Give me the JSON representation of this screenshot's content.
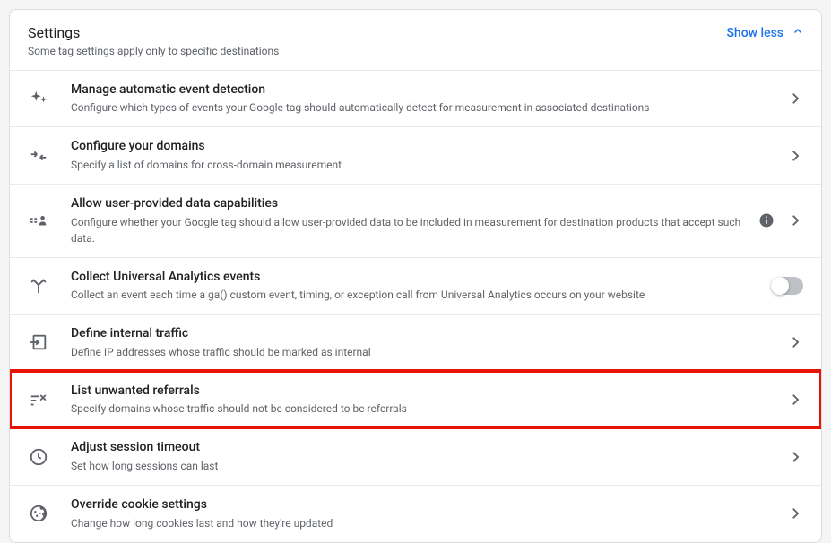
{
  "header": {
    "title": "Settings",
    "subtitle": "Some tag settings apply only to specific destinations",
    "toggle_label": "Show less"
  },
  "rows": [
    {
      "title": "Manage automatic event detection",
      "desc": "Configure which types of events your Google tag should automatically detect for measurement in associated destinations"
    },
    {
      "title": "Configure your domains",
      "desc": "Specify a list of domains for cross-domain measurement"
    },
    {
      "title": "Allow user-provided data capabilities",
      "desc": "Configure whether your Google tag should allow user-provided data to be included in measurement for destination products that accept such data."
    },
    {
      "title": "Collect Universal Analytics events",
      "desc": "Collect an event each time a ga() custom event, timing, or exception call from Universal Analytics occurs on your website"
    },
    {
      "title": "Define internal traffic",
      "desc": "Define IP addresses whose traffic should be marked as internal"
    },
    {
      "title": "List unwanted referrals",
      "desc": "Specify domains whose traffic should not be considered to be referrals"
    },
    {
      "title": "Adjust session timeout",
      "desc": "Set how long sessions can last"
    },
    {
      "title": "Override cookie settings",
      "desc": "Change how long cookies last and how they're updated"
    }
  ]
}
